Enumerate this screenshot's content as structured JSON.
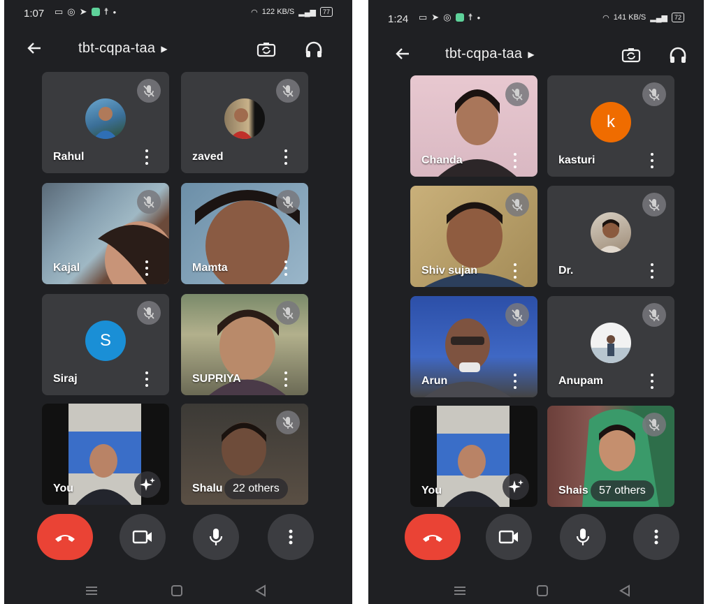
{
  "left": {
    "status": {
      "time": "1:07",
      "speed": "122",
      "speed_unit": "KB/S",
      "battery": "77"
    },
    "meeting": {
      "title": "tbt-cqpa-taa"
    },
    "tiles": [
      {
        "name": "Rahul"
      },
      {
        "name": "zaved"
      },
      {
        "name": "Kajal"
      },
      {
        "name": "Mamta"
      },
      {
        "name": "Siraj",
        "avatar_letter": "S",
        "avatar_color": "#1a8fd6"
      },
      {
        "name": "SUPRIYA"
      },
      {
        "name": "You"
      },
      {
        "name": "Shalu",
        "others": "22 others"
      }
    ]
  },
  "right": {
    "status": {
      "time": "1:24",
      "speed": "141",
      "speed_unit": "KB/S",
      "battery": "72"
    },
    "meeting": {
      "title": "tbt-cqpa-taa"
    },
    "tiles": [
      {
        "name": "Chanda"
      },
      {
        "name": "kasturi",
        "avatar_letter": "k",
        "avatar_color": "#ef6c00"
      },
      {
        "name": "Shiv sujan"
      },
      {
        "name": "Dr."
      },
      {
        "name": "Arun"
      },
      {
        "name": "Anupam"
      },
      {
        "name": "You"
      },
      {
        "name": "Shais",
        "others": "57 others"
      }
    ]
  },
  "theme": {
    "background": "#1f2023",
    "tile": "#3a3b3e",
    "end_call": "#ea4335",
    "control": "#3c3d41"
  },
  "icons": {
    "top_bar": [
      "back-arrow-icon",
      "switch-camera-icon",
      "headset-icon"
    ],
    "controls": [
      "end-call-icon",
      "camera-icon",
      "microphone-icon",
      "more-options-icon"
    ],
    "nav": [
      "menu-icon",
      "home-icon",
      "back-triangle-icon"
    ]
  }
}
